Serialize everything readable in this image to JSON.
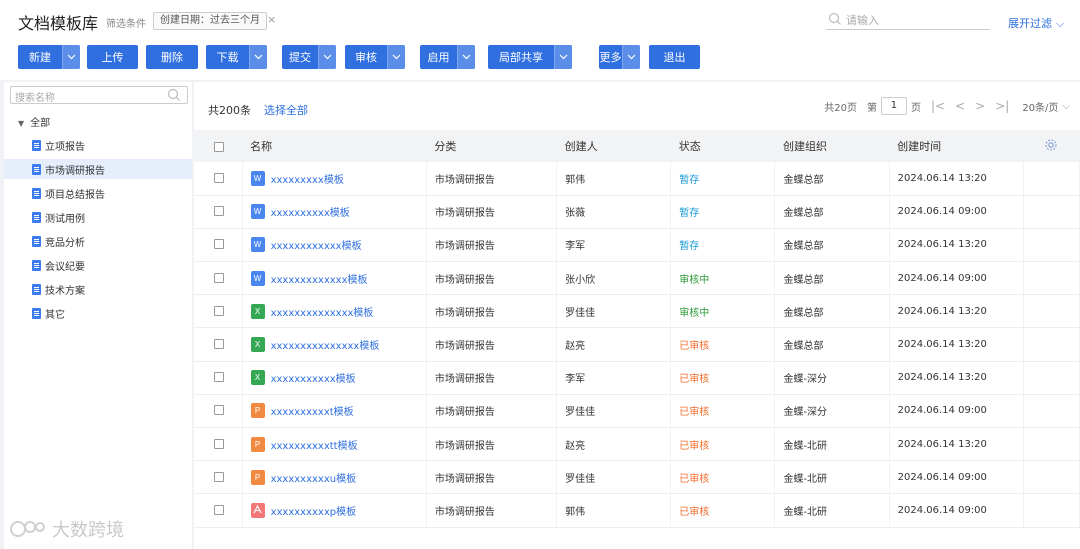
{
  "header": {
    "title": "文档模板库",
    "filter_label": "筛选条件",
    "filter_chip": "创建日期：过去三个月",
    "chip_close": "×",
    "search_placeholder": "请输入",
    "expand_filter": "展开过滤",
    "chevron_char": "⌵"
  },
  "toolbar": [
    {
      "label": "新建",
      "dropdown": true
    },
    {
      "label": "上传",
      "dropdown": false
    },
    {
      "label": "删除",
      "dropdown": false
    },
    {
      "label": "下载",
      "dropdown": true
    },
    {
      "label": "提交",
      "dropdown": true
    },
    {
      "label": "审核",
      "dropdown": true
    },
    {
      "label": "启用",
      "dropdown": true
    },
    {
      "label": "局部共享",
      "dropdown": true
    },
    {
      "label": "更多",
      "dropdown": true
    },
    {
      "label": "退出",
      "dropdown": false
    }
  ],
  "sidebar": {
    "search_placeholder": "搜索名称",
    "root_label": "全部",
    "items": [
      {
        "label": "立项报告",
        "selected": false
      },
      {
        "label": "市场调研报告",
        "selected": true
      },
      {
        "label": "项目总结报告",
        "selected": false
      },
      {
        "label": "测试用例",
        "selected": false
      },
      {
        "label": "竞品分析",
        "selected": false
      },
      {
        "label": "会议纪要",
        "selected": false
      },
      {
        "label": "技术方案",
        "selected": false
      },
      {
        "label": "其它",
        "selected": false
      }
    ]
  },
  "main": {
    "total": "共200条",
    "select_all": "选择全部",
    "pager": {
      "total_pages": "共20页",
      "page_prefix": "第",
      "current_page": "1",
      "page_suffix": "页",
      "page_size": "20条/页"
    },
    "columns": [
      "名称",
      "分类",
      "创建人",
      "状态",
      "创建组织",
      "创建时间"
    ],
    "rows": [
      {
        "type": "W",
        "name": "xxxxxxxxx模板",
        "category": "市场调研报告",
        "creator": "郭伟",
        "status": "暂存",
        "status_kind": "draft",
        "org": "金蝶总部",
        "time": "2024.06.14  13:20"
      },
      {
        "type": "W",
        "name": "xxxxxxxxxx模板",
        "category": "市场调研报告",
        "creator": "张薇",
        "status": "暂存",
        "status_kind": "draft",
        "org": "金蝶总部",
        "time": "2024.06.14  09:00"
      },
      {
        "type": "W",
        "name": "xxxxxxxxxxxx模板",
        "category": "市场调研报告",
        "creator": "李军",
        "status": "暂存",
        "status_kind": "draft",
        "org": "金蝶总部",
        "time": "2024.06.14  13:20"
      },
      {
        "type": "W",
        "name": "xxxxxxxxxxxxx模板",
        "category": "市场调研报告",
        "creator": "张小欣",
        "status": "审核中",
        "status_kind": "review",
        "org": "金蝶总部",
        "time": "2024.06.14  09:00"
      },
      {
        "type": "X",
        "name": "xxxxxxxxxxxxxx模板",
        "category": "市场调研报告",
        "creator": "罗佳佳",
        "status": "审核中",
        "status_kind": "review",
        "org": "金蝶总部",
        "time": "2024.06.14  13:20"
      },
      {
        "type": "X",
        "name": "xxxxxxxxxxxxxxx模板",
        "category": "市场调研报告",
        "creator": "赵亮",
        "status": "已审核",
        "status_kind": "done",
        "org": "金蝶总部",
        "time": "2024.06.14  13:20"
      },
      {
        "type": "X",
        "name": "xxxxxxxxxxx模板",
        "category": "市场调研报告",
        "creator": "李军",
        "status": "已审核",
        "status_kind": "done",
        "org": "金蝶-深分",
        "time": "2024.06.14  13:20"
      },
      {
        "type": "P",
        "name": "xxxxxxxxxxt模板",
        "category": "市场调研报告",
        "creator": "罗佳佳",
        "status": "已审核",
        "status_kind": "done",
        "org": "金蝶-深分",
        "time": "2024.06.14  09:00"
      },
      {
        "type": "P",
        "name": "xxxxxxxxxxtt模板",
        "category": "市场调研报告",
        "creator": "赵亮",
        "status": "已审核",
        "status_kind": "done",
        "org": "金蝶-北研",
        "time": "2024.06.14  13:20"
      },
      {
        "type": "P",
        "name": "xxxxxxxxxxu模板",
        "category": "市场调研报告",
        "creator": "罗佳佳",
        "status": "已审核",
        "status_kind": "done",
        "org": "金蝶-北研",
        "time": "2024.06.14  09:00"
      },
      {
        "type": "PDF",
        "name": "xxxxxxxxxxp模板",
        "category": "市场调研报告",
        "creator": "郭伟",
        "status": "已审核",
        "status_kind": "done",
        "org": "金蝶-北研",
        "time": "2024.06.14  09:00"
      }
    ]
  },
  "watermark": "大数跨境",
  "colors": {
    "accent": "#2f6fe0",
    "word_icon": "#4a86ef",
    "excel_icon": "#35a853",
    "ppt_icon": "#f08a40",
    "pdf_icon": "#f27878",
    "status_draft": "#1a9bd7",
    "status_review": "#2e9a3a",
    "status_done": "#f06d2c"
  }
}
